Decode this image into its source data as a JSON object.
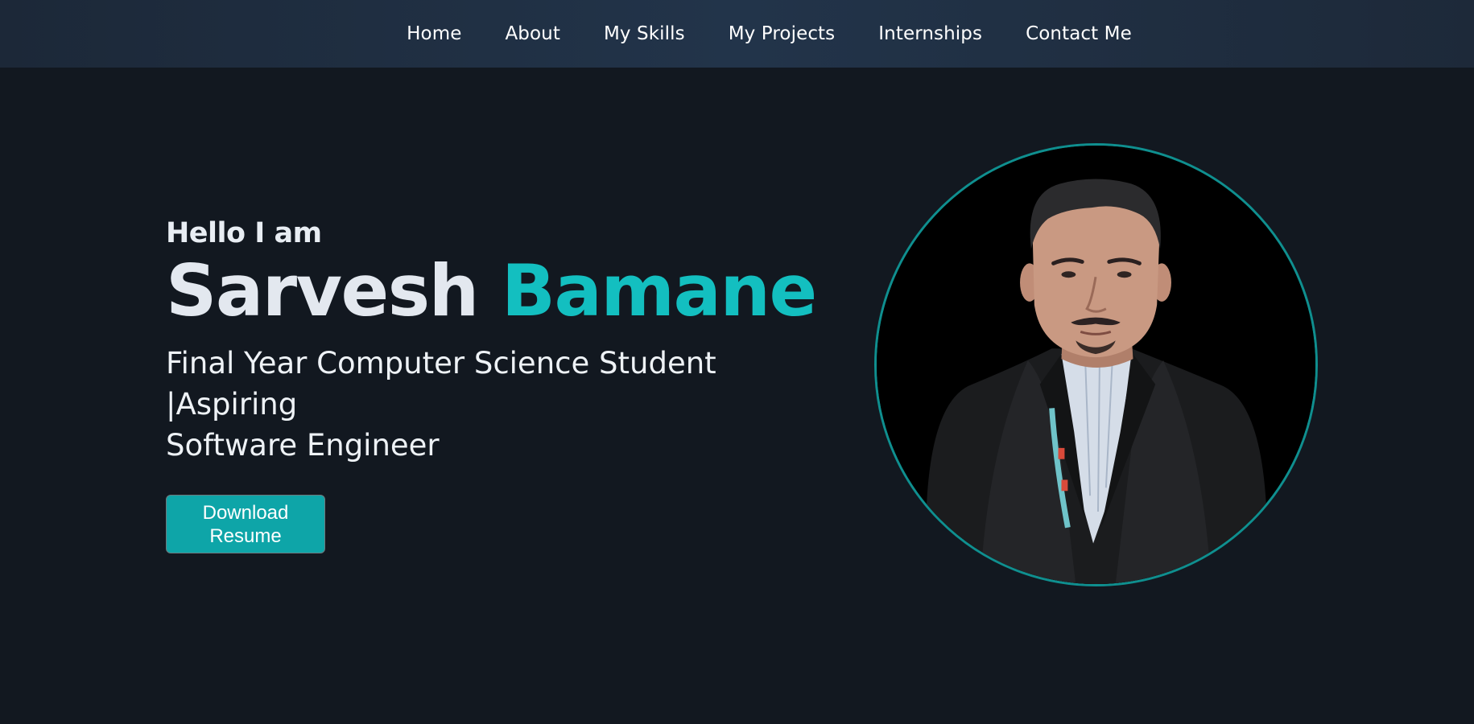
{
  "nav": {
    "items": [
      {
        "label": "Home"
      },
      {
        "label": "About"
      },
      {
        "label": "My Skills"
      },
      {
        "label": "My Projects"
      },
      {
        "label": "Internships"
      },
      {
        "label": "Contact Me"
      }
    ]
  },
  "hero": {
    "greeting": "Hello I am",
    "first_name": "Sarvesh",
    "last_name": "Bamane",
    "tagline_line1": "Final Year Computer Science Student |Aspiring",
    "tagline_line2": "Software Engineer",
    "download_button_line1": "Download",
    "download_button_line2": "Resume"
  },
  "colors": {
    "background": "#121820",
    "navbar": "#22344a",
    "accent": "#13bfc0",
    "button": "#0ea5a8",
    "portrait_ring": "#0f8f8f"
  }
}
